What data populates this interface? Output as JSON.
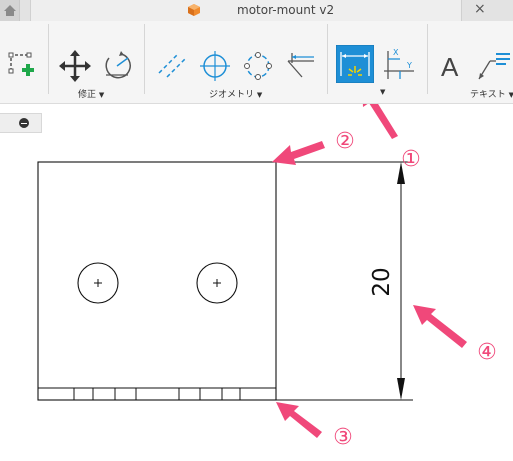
{
  "tabs": {
    "document_title": "motor-mount v2",
    "close_glyph": "×"
  },
  "ribbon": {
    "groups": {
      "modify_label": "修正",
      "geometry_label": "ジオメトリ",
      "text_label": "テキスト"
    },
    "text_tool_glyph": "A",
    "caret": "▼"
  },
  "drawing": {
    "dimension_value": "20"
  },
  "callouts": [
    "①",
    "②",
    "③",
    "④"
  ],
  "colors": {
    "accent_selected": "#1e8fd6",
    "callout_pink": "#f0487a",
    "plus_green": "#1fa84a"
  }
}
